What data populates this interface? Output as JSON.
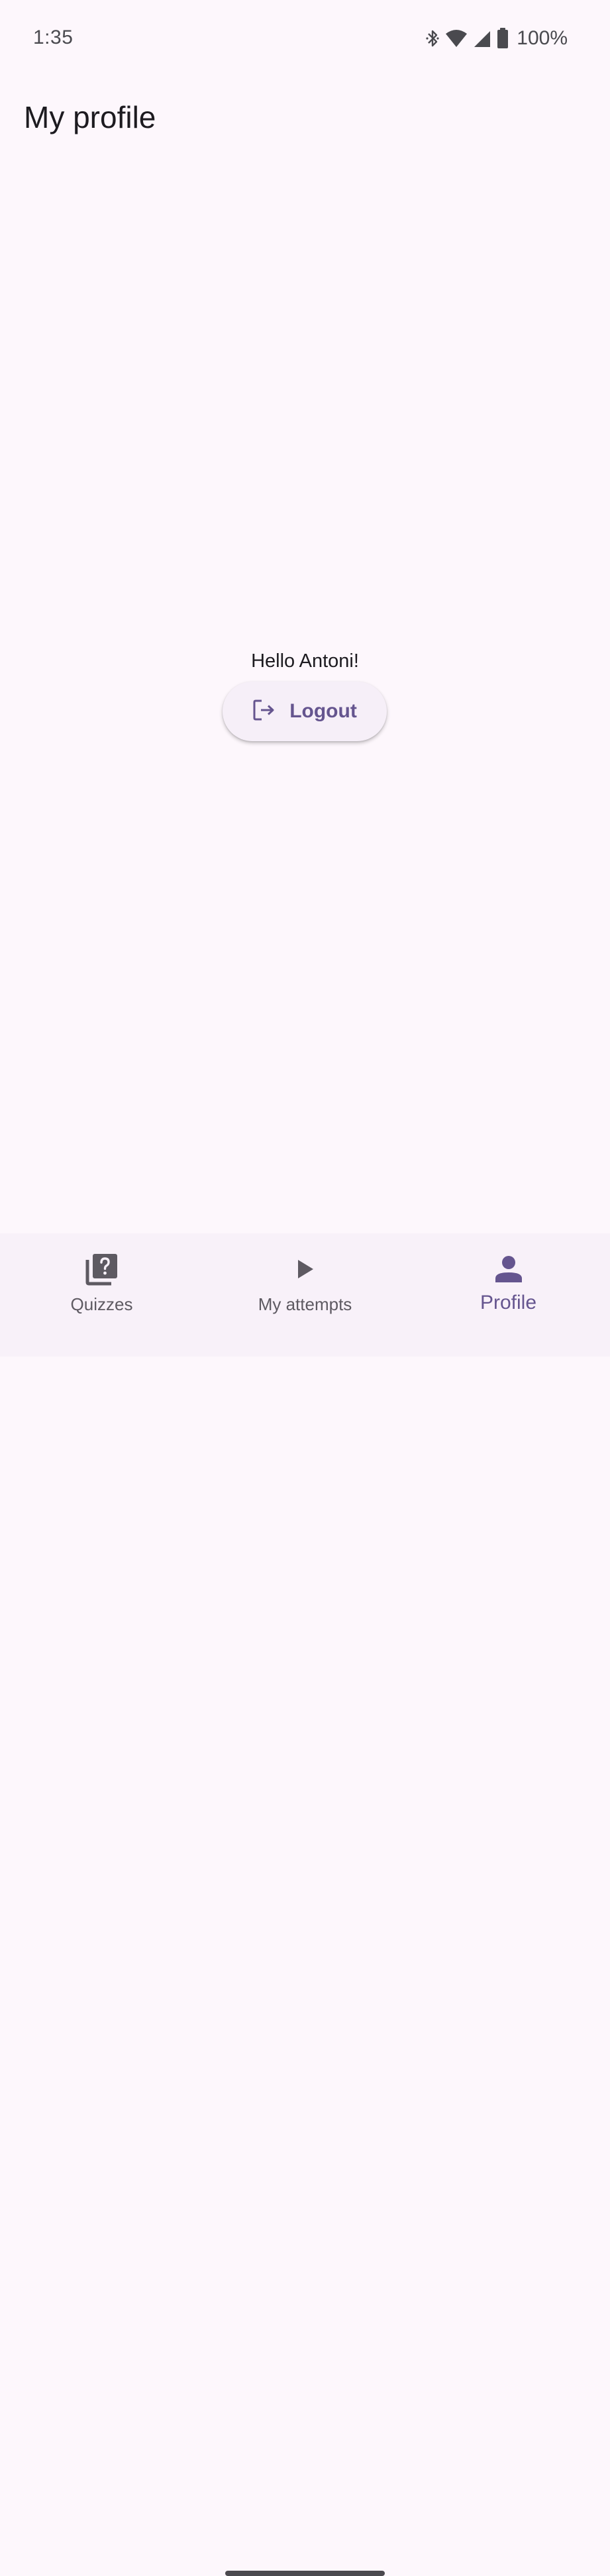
{
  "status_bar": {
    "time": "1:35",
    "battery": "100%",
    "icons": [
      "bluetooth-icon",
      "wifi-icon",
      "cell-signal-icon",
      "battery-icon"
    ]
  },
  "page": {
    "title": "My profile"
  },
  "content": {
    "greeting": "Hello Antoni!",
    "logout_label": "Logout",
    "logout_icon": "logout-icon"
  },
  "bottom_nav": {
    "items": [
      {
        "label": "Quizzes",
        "icon": "quiz-icon",
        "active": false
      },
      {
        "label": "My attempts",
        "icon": "play-icon",
        "active": false
      },
      {
        "label": "Profile",
        "icon": "person-icon",
        "active": true
      }
    ]
  },
  "colors": {
    "background": "#FDF7FC",
    "accent": "#65558F",
    "nav_background": "#F8F1F9",
    "button_background": "#F6EFF8",
    "inactive": "#5E5A62"
  }
}
